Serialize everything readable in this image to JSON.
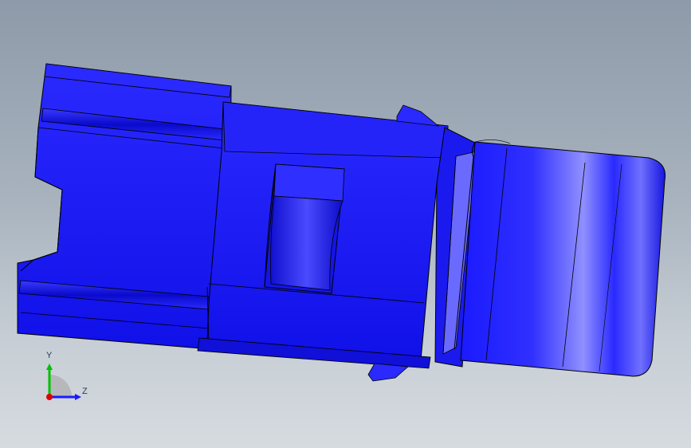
{
  "viewport": {
    "background_top": "#8d9aa9",
    "background_bottom": "#d6dbe0"
  },
  "model": {
    "part_color": "#1a1aff",
    "edge_color": "#000000",
    "highlight_color": "#8a8aff"
  },
  "triad": {
    "y_label": "Y",
    "z_label": "Z",
    "y_color": "#00c000",
    "z_color": "#1a1aff",
    "x_color": "#e00000"
  }
}
